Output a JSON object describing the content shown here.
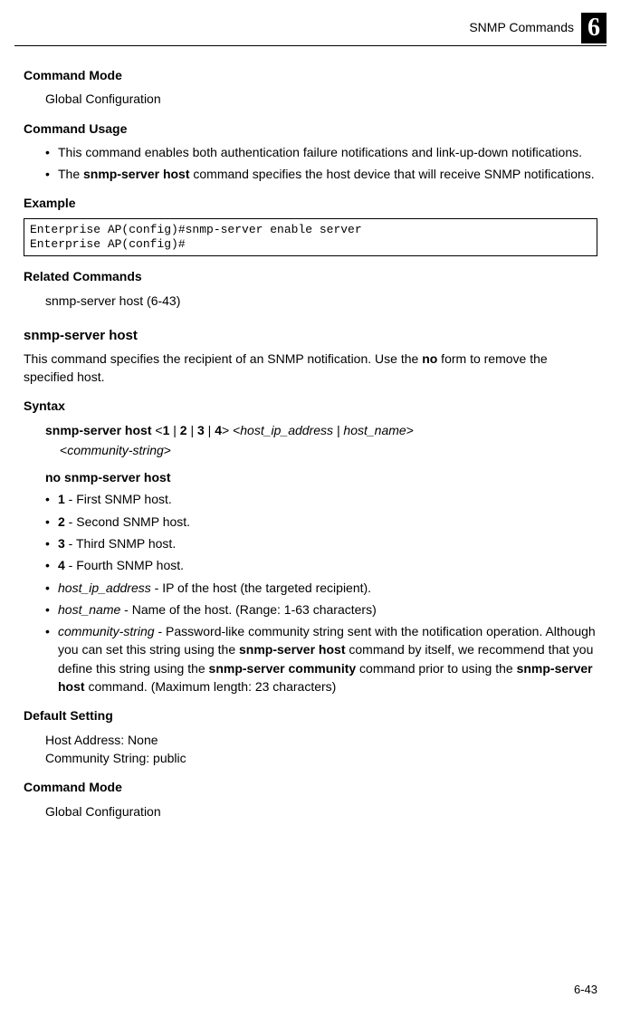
{
  "header": {
    "title": "SNMP Commands",
    "chapter_num": "6"
  },
  "sec1": {
    "mode_h": "Command Mode",
    "mode_text": "Global Configuration",
    "usage_h": "Command Usage",
    "usage_b1_a": "This command enables both authentication failure notifications and link-up-down notifications.",
    "usage_b2_pre": "The ",
    "usage_b2_cmd": "snmp-server host",
    "usage_b2_post": " command specifies the host device that will receive SNMP notifications.",
    "example_h": "Example",
    "example_code": "Enterprise AP(config)#snmp-server enable server\nEnterprise AP(config)#",
    "related_h": "Related Commands",
    "related_text": "snmp-server host (6-43)"
  },
  "sec2": {
    "title": "snmp-server host",
    "desc_pre": "This command specifies the recipient of an SNMP notification. Use the ",
    "desc_no": "no",
    "desc_post": " form to remove the specified host.",
    "syntax_h": "Syntax",
    "syn_line1_a": "snmp-server host",
    "syn_line1_b": " <",
    "syn_line1_1": "1",
    "syn_line1_p1": " | ",
    "syn_line1_2": "2",
    "syn_line1_p2": " | ",
    "syn_line1_3": "3",
    "syn_line1_p3": " | ",
    "syn_line1_4": "4",
    "syn_line1_c": "> <",
    "syn_line1_host": "host_ip_address | host_name",
    "syn_line1_d": ">",
    "syn_line2_a": "<",
    "syn_line2_cs": "community-string",
    "syn_line2_b": ">",
    "syn_no": "no snmp-server host",
    "b1_a": "1",
    "b1_b": " - First SNMP host.",
    "b2_a": "2",
    "b2_b": " - Second SNMP host.",
    "b3_a": "3",
    "b3_b": " - Third SNMP host.",
    "b4_a": "4",
    "b4_b": " - Fourth SNMP host.",
    "b5_a": "host_ip_address",
    "b5_b": " - IP of the host (the targeted recipient).",
    "b6_a": "host_name",
    "b6_b": " - Name of the host. (Range: 1-63 characters)",
    "b7_a": "community-string",
    "b7_b1": " - Password-like community string sent with the notification operation. Although you can set this string using the ",
    "b7_cmd1": "snmp-server host",
    "b7_b2": " command by itself, we recommend that you define this string using the ",
    "b7_cmd2": "snmp-server community",
    "b7_b3": " command prior to using the ",
    "b7_cmd3": "snmp-server host",
    "b7_b4": " command. (Maximum length: 23 characters)",
    "default_h": "Default Setting",
    "default_l1": "Host Address: None",
    "default_l2": "Community String: public",
    "mode_h": "Command Mode",
    "mode_text": "Global Configuration"
  },
  "footer": {
    "page": "6-43"
  }
}
